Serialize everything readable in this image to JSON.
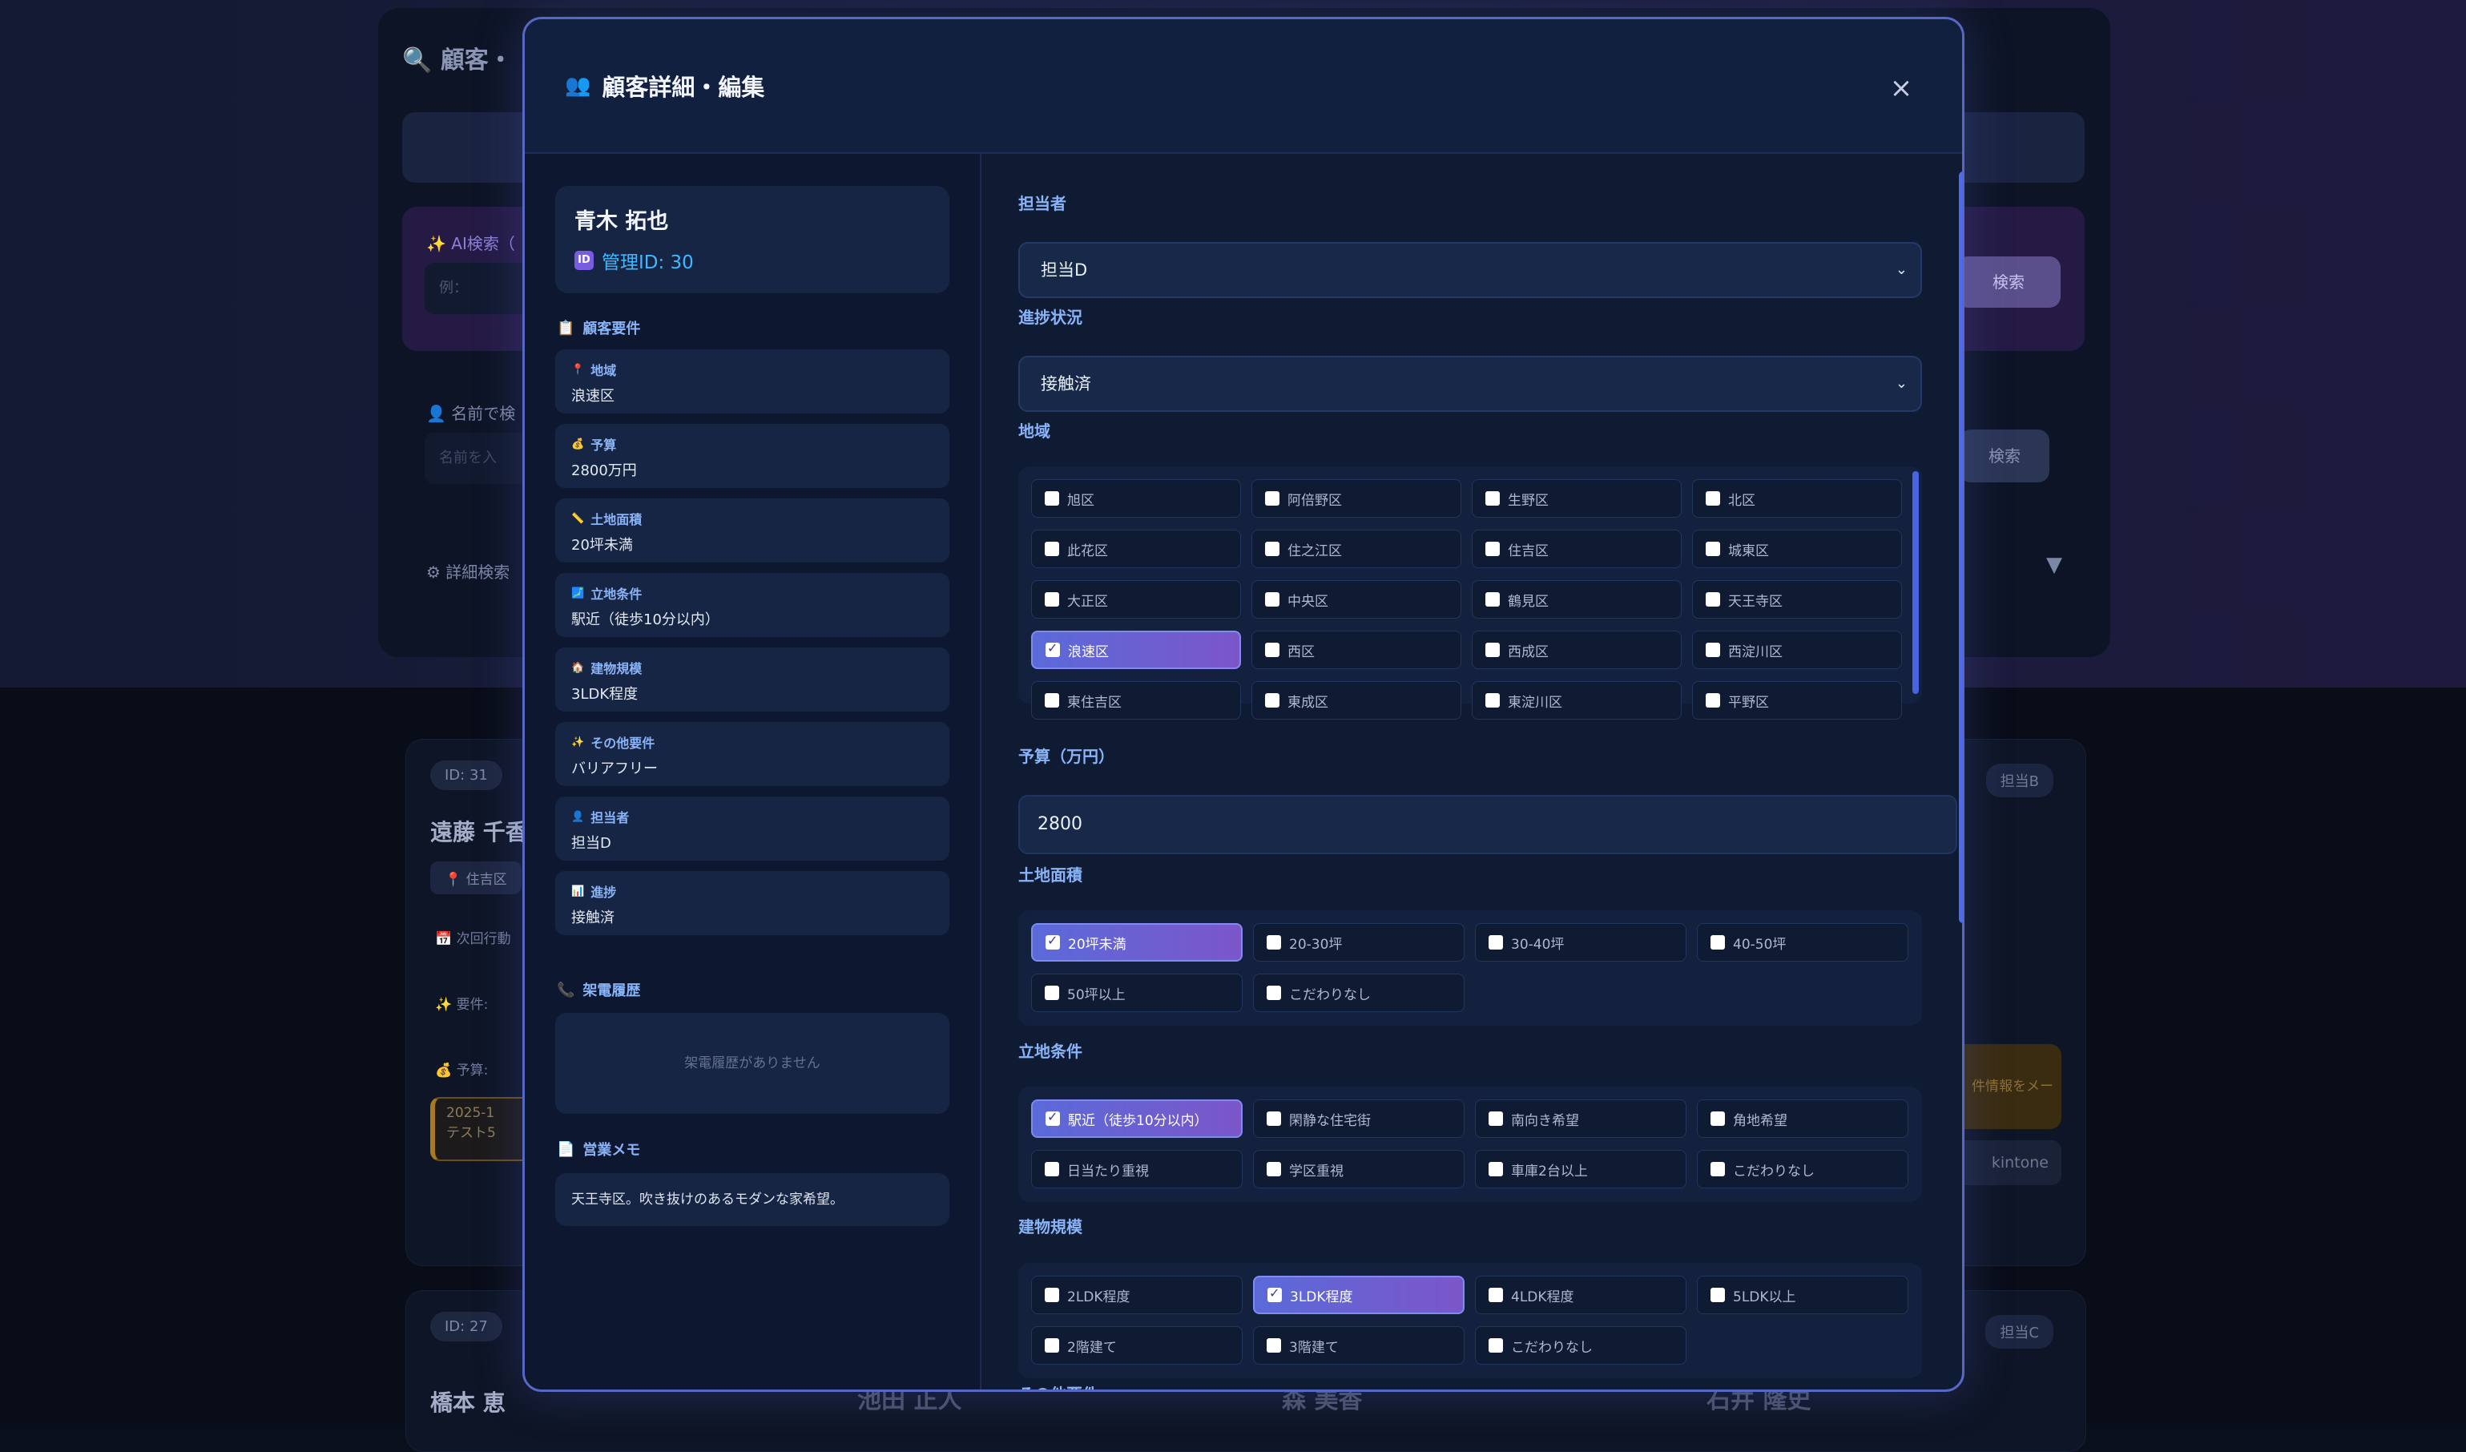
{
  "background": {
    "title": "顧客・",
    "ai_search_label": "AI検索（",
    "ai_search_placeholder": "例：",
    "ai_search_button": "検索",
    "name_search_label": "名前で検",
    "name_search_placeholder": "名前を入",
    "name_search_button": "検索",
    "detail_search_label": "詳細検索",
    "card1": {
      "id": "ID: 31",
      "name": "遠藤 千香",
      "area": "住吉区",
      "next_action": "次回行動",
      "requirement": "要件:",
      "budget": "予算:",
      "event_date": "2025-1",
      "event_text": "テスト5",
      "assignee": "担当B",
      "notify_button": "件情報をメー",
      "kintone": "kintone"
    },
    "card2": {
      "id": "ID: 27",
      "name": "橋本 恵",
      "assignee": "担当C"
    },
    "bottom_names": [
      "池田 正人",
      "森 美香",
      "石井 隆史"
    ]
  },
  "modal": {
    "title": "顧客詳細・編集",
    "title_icon": "people-icon",
    "close_label": "×",
    "customer": {
      "name": "青木 拓也",
      "management_id": "管理ID: 30",
      "id_badge": "ID"
    },
    "requirements_heading": "顧客要件",
    "requirements": [
      {
        "icon": "📍",
        "label": "地域",
        "value": "浪速区"
      },
      {
        "icon": "💰",
        "label": "予算",
        "value": "2800万円"
      },
      {
        "icon": "📏",
        "label": "土地面積",
        "value": "20坪未満"
      },
      {
        "icon": "🗾",
        "label": "立地条件",
        "value": "駅近（徒歩10分以内）"
      },
      {
        "icon": "🏠",
        "label": "建物規模",
        "value": "3LDK程度"
      },
      {
        "icon": "✨",
        "label": "その他要件",
        "value": "バリアフリー"
      },
      {
        "icon": "👤",
        "label": "担当者",
        "value": "担当D"
      },
      {
        "icon": "📊",
        "label": "進捗",
        "value": "接触済"
      }
    ],
    "call_history_heading": "架電履歴",
    "call_history_empty": "架電履歴がありません",
    "memo_heading": "営業メモ",
    "memo_text": "天王寺区。吹き抜けのあるモダンな家希望。",
    "form": {
      "assignee_label": "担当者",
      "assignee_value": "担当D",
      "status_label": "進捗状況",
      "status_value": "接触済",
      "region_label": "地域",
      "regions": [
        {
          "label": "旭区",
          "checked": false
        },
        {
          "label": "阿倍野区",
          "checked": false
        },
        {
          "label": "生野区",
          "checked": false
        },
        {
          "label": "北区",
          "checked": false
        },
        {
          "label": "此花区",
          "checked": false
        },
        {
          "label": "住之江区",
          "checked": false
        },
        {
          "label": "住吉区",
          "checked": false
        },
        {
          "label": "城東区",
          "checked": false
        },
        {
          "label": "大正区",
          "checked": false
        },
        {
          "label": "中央区",
          "checked": false
        },
        {
          "label": "鶴見区",
          "checked": false
        },
        {
          "label": "天王寺区",
          "checked": false
        },
        {
          "label": "浪速区",
          "checked": true
        },
        {
          "label": "西区",
          "checked": false
        },
        {
          "label": "西成区",
          "checked": false
        },
        {
          "label": "西淀川区",
          "checked": false
        },
        {
          "label": "東住吉区",
          "checked": false
        },
        {
          "label": "東成区",
          "checked": false
        },
        {
          "label": "東淀川区",
          "checked": false
        },
        {
          "label": "平野区",
          "checked": false
        }
      ],
      "budget_label": "予算（万円）",
      "budget_value": "2800",
      "land_label": "土地面積",
      "land_options": [
        {
          "label": "20坪未満",
          "checked": true
        },
        {
          "label": "20-30坪",
          "checked": false
        },
        {
          "label": "30-40坪",
          "checked": false
        },
        {
          "label": "40-50坪",
          "checked": false
        },
        {
          "label": "50坪以上",
          "checked": false
        },
        {
          "label": "こだわりなし",
          "checked": false
        }
      ],
      "location_label": "立地条件",
      "location_options": [
        {
          "label": "駅近（徒歩10分以内）",
          "checked": true
        },
        {
          "label": "閑静な住宅街",
          "checked": false
        },
        {
          "label": "南向き希望",
          "checked": false
        },
        {
          "label": "角地希望",
          "checked": false
        },
        {
          "label": "日当たり重視",
          "checked": false
        },
        {
          "label": "学区重視",
          "checked": false
        },
        {
          "label": "車庫2台以上",
          "checked": false
        },
        {
          "label": "こだわりなし",
          "checked": false
        }
      ],
      "building_label": "建物規模",
      "building_options": [
        {
          "label": "2LDK程度",
          "checked": false
        },
        {
          "label": "3LDK程度",
          "checked": true
        },
        {
          "label": "4LDK程度",
          "checked": false
        },
        {
          "label": "5LDK以上",
          "checked": false
        },
        {
          "label": "2階建て",
          "checked": false
        },
        {
          "label": "3階建て",
          "checked": false
        },
        {
          "label": "こだわりなし",
          "checked": false
        }
      ],
      "next_label": "その他要件"
    }
  },
  "colors": {
    "accent": "#5b6ad9",
    "label": "#8ab4f8",
    "id_text": "#42b6ff",
    "modal_bg": "#0f1a33"
  }
}
